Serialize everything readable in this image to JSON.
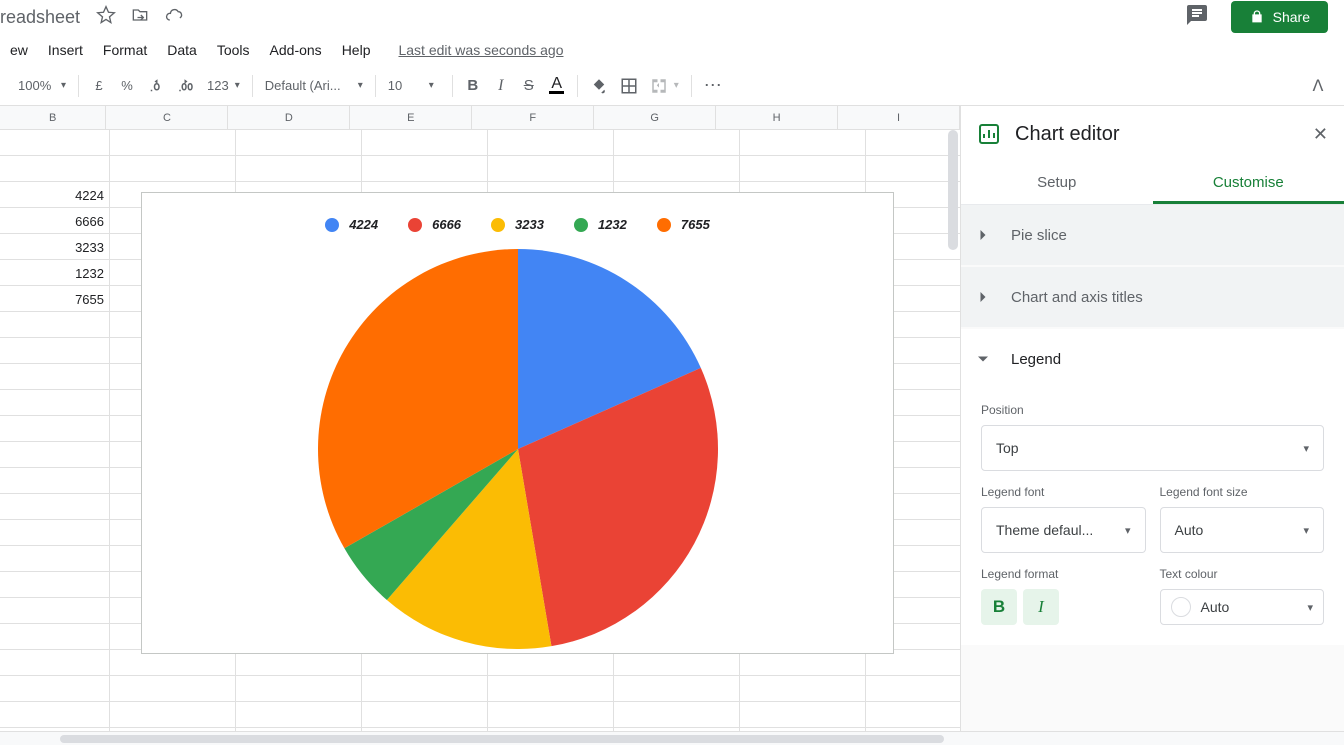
{
  "title": "readsheet",
  "menus": {
    "view": "ew",
    "insert": "Insert",
    "format": "Format",
    "data": "Data",
    "tools": "Tools",
    "addons": "Add-ons",
    "help": "Help"
  },
  "last_edit": "Last edit was seconds ago",
  "share_label": "Share",
  "toolbar": {
    "zoom": "100%",
    "currency": "£",
    "percent": "%",
    "dec_dec": ".0",
    "dec_inc": ".00",
    "num_fmt": "123",
    "font": "Default (Ari...",
    "font_size": "10",
    "text_color_letter": "A",
    "more": "⋯"
  },
  "columns": [
    "B",
    "C",
    "D",
    "E",
    "F",
    "G",
    "H",
    "I"
  ],
  "cell_values": [
    "4224",
    "6666",
    "3233",
    "1232",
    "7655"
  ],
  "chart_data": {
    "type": "pie",
    "title": "",
    "categories": [
      "4224",
      "6666",
      "3233",
      "1232",
      "7655"
    ],
    "values": [
      4224,
      6666,
      3233,
      1232,
      7655
    ],
    "colors": [
      "#4285f4",
      "#ea4335",
      "#fbbc04",
      "#34a853",
      "#ff6d01"
    ],
    "legend_position": "Top"
  },
  "sidebar": {
    "title": "Chart editor",
    "tabs": {
      "setup": "Setup",
      "customise": "Customise"
    },
    "sections": {
      "pie_slice": "Pie slice",
      "chart_axis": "Chart and axis titles",
      "legend": "Legend"
    },
    "legend_panel": {
      "position_label": "Position",
      "position_value": "Top",
      "font_label": "Legend font",
      "font_value": "Theme defaul...",
      "size_label": "Legend font size",
      "size_value": "Auto",
      "format_label": "Legend format",
      "bold": "B",
      "italic": "I",
      "text_colour_label": "Text colour",
      "text_colour_value": "Auto"
    }
  }
}
